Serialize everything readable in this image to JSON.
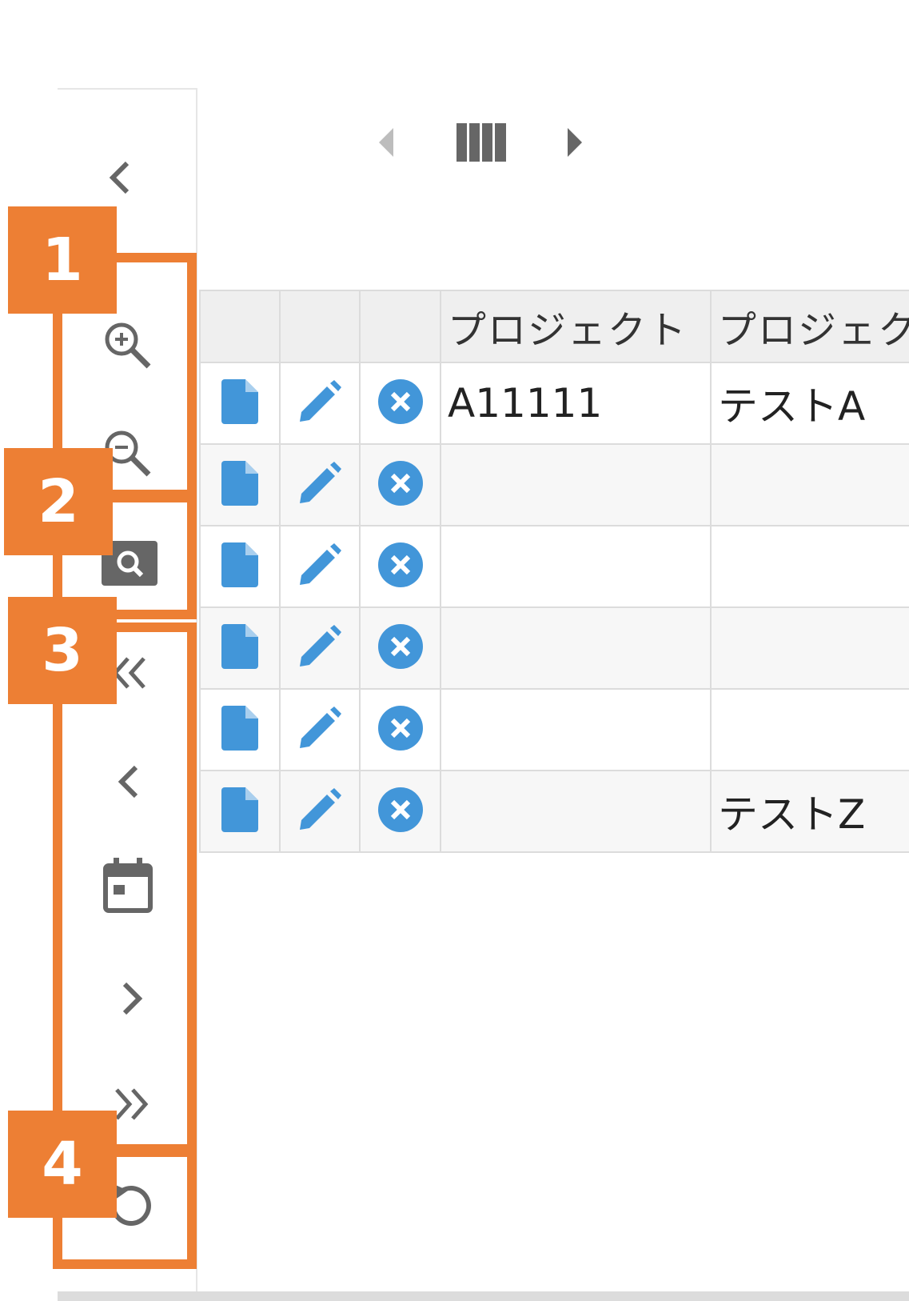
{
  "colors": {
    "accent": "#ed7f34",
    "action_blue": "#4296d9",
    "icon_gray": "#666666"
  },
  "sidebar": {
    "items": [
      {
        "icon": "chevron-left-icon"
      },
      {
        "icon": "zoom-in-icon"
      },
      {
        "icon": "zoom-out-icon"
      },
      {
        "icon": "zoom-fit-icon"
      },
      {
        "icon": "double-chevron-left-icon"
      },
      {
        "icon": "chevron-left-icon"
      },
      {
        "icon": "calendar-icon"
      },
      {
        "icon": "chevron-right-icon"
      },
      {
        "icon": "double-chevron-right-icon"
      },
      {
        "icon": "refresh-icon"
      }
    ]
  },
  "header_nav": {
    "prev_icon": "caret-left-icon",
    "columns_icon": "columns-icon",
    "next_icon": "caret-right-icon"
  },
  "grid": {
    "columns": [
      "",
      "",
      "",
      "プロジェクト",
      "プロジェクト"
    ],
    "row_actions": [
      "file-icon",
      "pencil-icon",
      "delete-circle-icon"
    ],
    "rows": [
      {
        "code": "A11111",
        "name": "テストA"
      },
      {
        "code": "",
        "name": ""
      },
      {
        "code": "",
        "name": ""
      },
      {
        "code": "",
        "name": ""
      },
      {
        "code": "",
        "name": ""
      },
      {
        "code": "",
        "name": "テストZ"
      }
    ]
  },
  "callouts": [
    "1",
    "2",
    "3",
    "4"
  ]
}
